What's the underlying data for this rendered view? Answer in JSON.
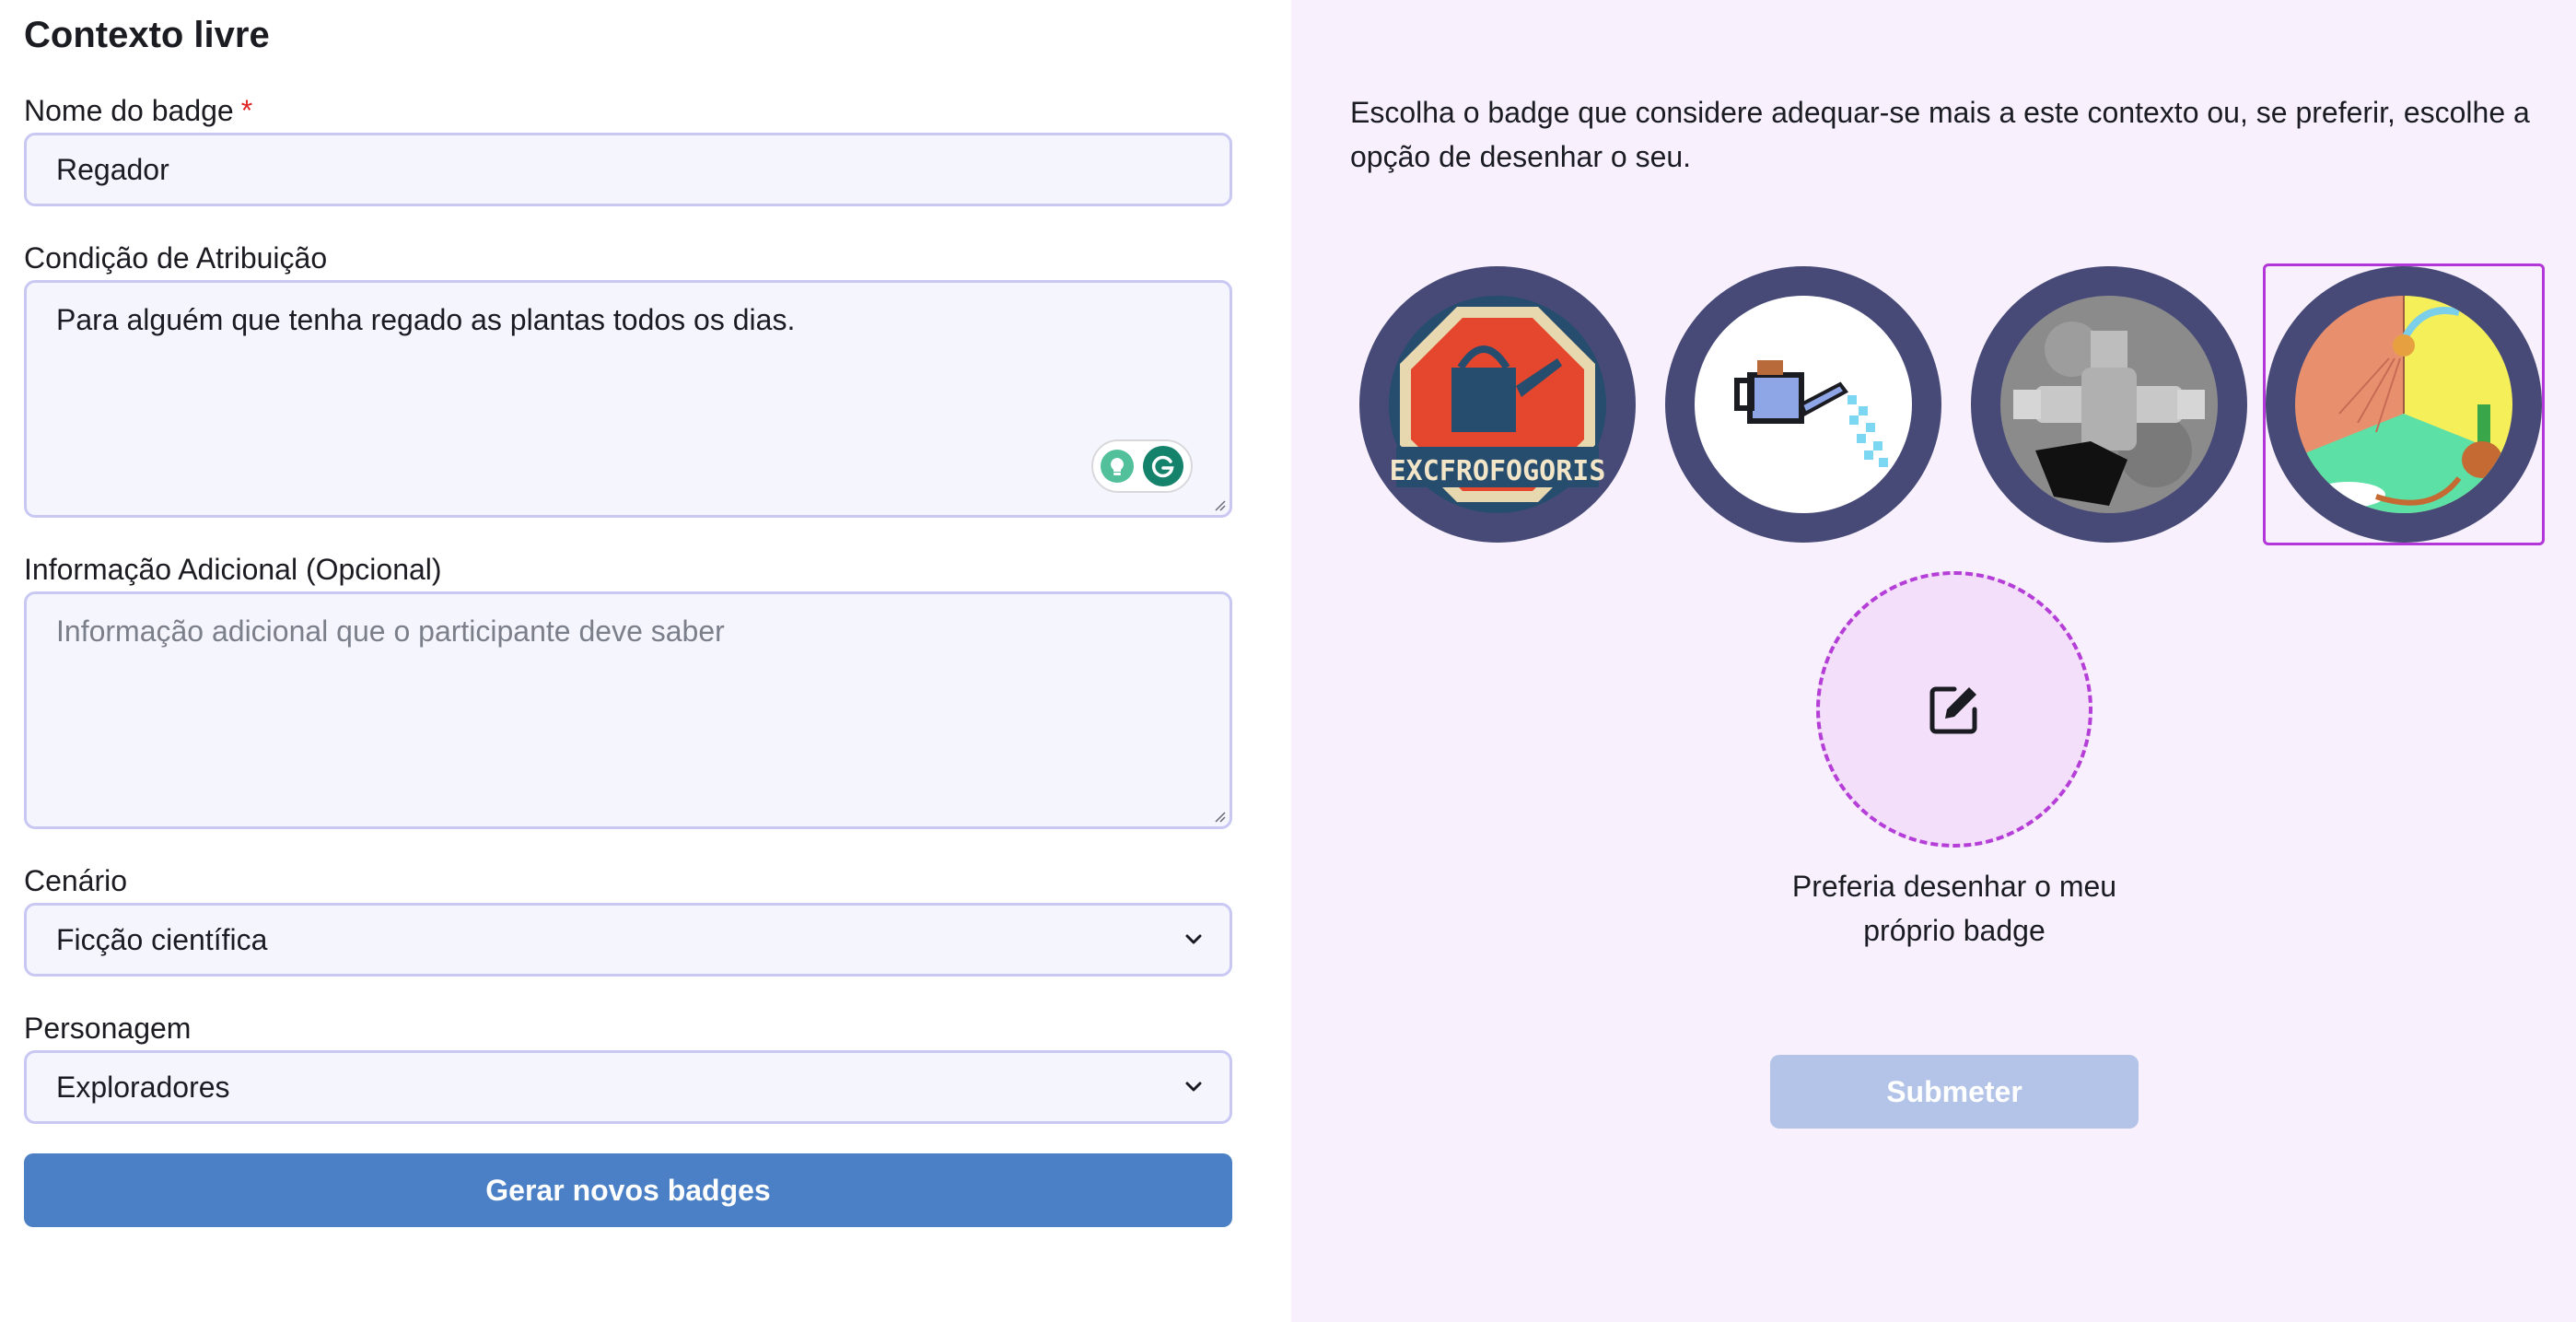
{
  "form": {
    "title": "Contexto livre",
    "badge_name": {
      "label": "Nome do badge",
      "required_mark": "*",
      "value": "Regador"
    },
    "condition": {
      "label": "Condição de Atribuição",
      "value": "Para alguém que tenha regado as plantas todos os dias."
    },
    "additional_info": {
      "label": "Informação Adicional (Opcional)",
      "placeholder": "Informação adicional que o participante deve saber",
      "value": ""
    },
    "scenario": {
      "label": "Cenário",
      "selected": "Ficção científica"
    },
    "character": {
      "label": "Personagem",
      "selected": "Exploradores"
    },
    "generate_button": "Gerar novos badges"
  },
  "badges": {
    "intro": "Escolha o badge que considere adequar-se mais a este contexto ou, se preferir, escolhe a opção de desenhar o seu.",
    "options": [
      {
        "id": "badge-1",
        "text": "EXCFROFOGORIS",
        "selected": false
      },
      {
        "id": "badge-2",
        "selected": false
      },
      {
        "id": "badge-3",
        "selected": false
      },
      {
        "id": "badge-4",
        "selected": true
      }
    ],
    "draw_own_label": "Preferia desenhar o meu próprio badge",
    "submit_button": "Submeter"
  },
  "colors": {
    "primary_button": "#4b80c7",
    "submit_disabled": "#b3c4e8",
    "selected_border": "#b337d8",
    "badge_ring": "#474a77",
    "right_panel_bg": "#f8f1fd",
    "required": "#e02424"
  }
}
